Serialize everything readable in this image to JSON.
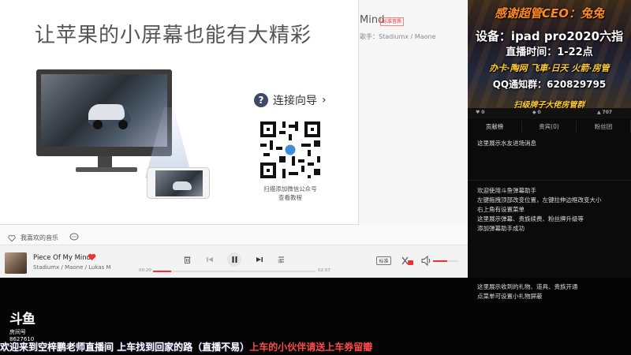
{
  "player": {
    "bg_song_title": "Mind",
    "bg_tag": "标准音质",
    "bg_singer": "歌手：Stadiumx / Maone",
    "promo": {
      "title": "让苹果的小屏幕也能有大精彩",
      "guide_label": "连接向导",
      "guide_arrow": "›",
      "qr_caption_1": "扫描添加微信公众号",
      "qr_caption_2": "查看教程"
    },
    "like_label": "我喜欢的音乐",
    "now_playing": {
      "title": "Piece Of My Mind",
      "artist": "Stadiumx / Maone / Lukas M",
      "time_current": "00:20",
      "time_total": "02:57",
      "progress": 0.11,
      "quality": "标准",
      "volume": 0.55
    }
  },
  "stream_panel": {
    "banner": {
      "line1": "感谢超管CEO：兔兔",
      "line2": "设备：ipad pro2020六指",
      "line3": "直播时间：1-22点",
      "line4": "办卡·陶网 飞車·日天 火箭·房管",
      "line5": "QQ通知群：620829795",
      "line6": "扫级牌子大佬房管群"
    },
    "rank": {
      "count1": "0",
      "count2": "0",
      "count3": "707"
    },
    "tabs": [
      "贡献榜",
      "贵宾(0)",
      "粉丝团"
    ],
    "msg1": "这里展示水友进场消息",
    "msg2": "欢迎使用斗鱼弹幕助手\n左键拖拽顶部改变位置，左键拉伸边框改变大小\n右上角有设置菜单\n这里展示弹幕、贵族续费、粉丝牌升级等\n添加弹幕助手成功",
    "msg3": "这里展示收到的礼物、道具、贵族开通\n点菜单可设置小礼物屏蔽"
  },
  "douyu": {
    "logo": "斗鱼",
    "room_label": "房间号",
    "room_num": "8627610"
  },
  "ticker": {
    "white_part": "欢迎来到空梓鹏老师直播间 上车找到回家的路（直播不易）",
    "red_part": "上车的小伙伴请送上车券留瓣"
  },
  "colors": {
    "accent_red": "#e33333",
    "banner_orange": "#ff8a1f",
    "banner_yellow": "#ffcc33"
  }
}
